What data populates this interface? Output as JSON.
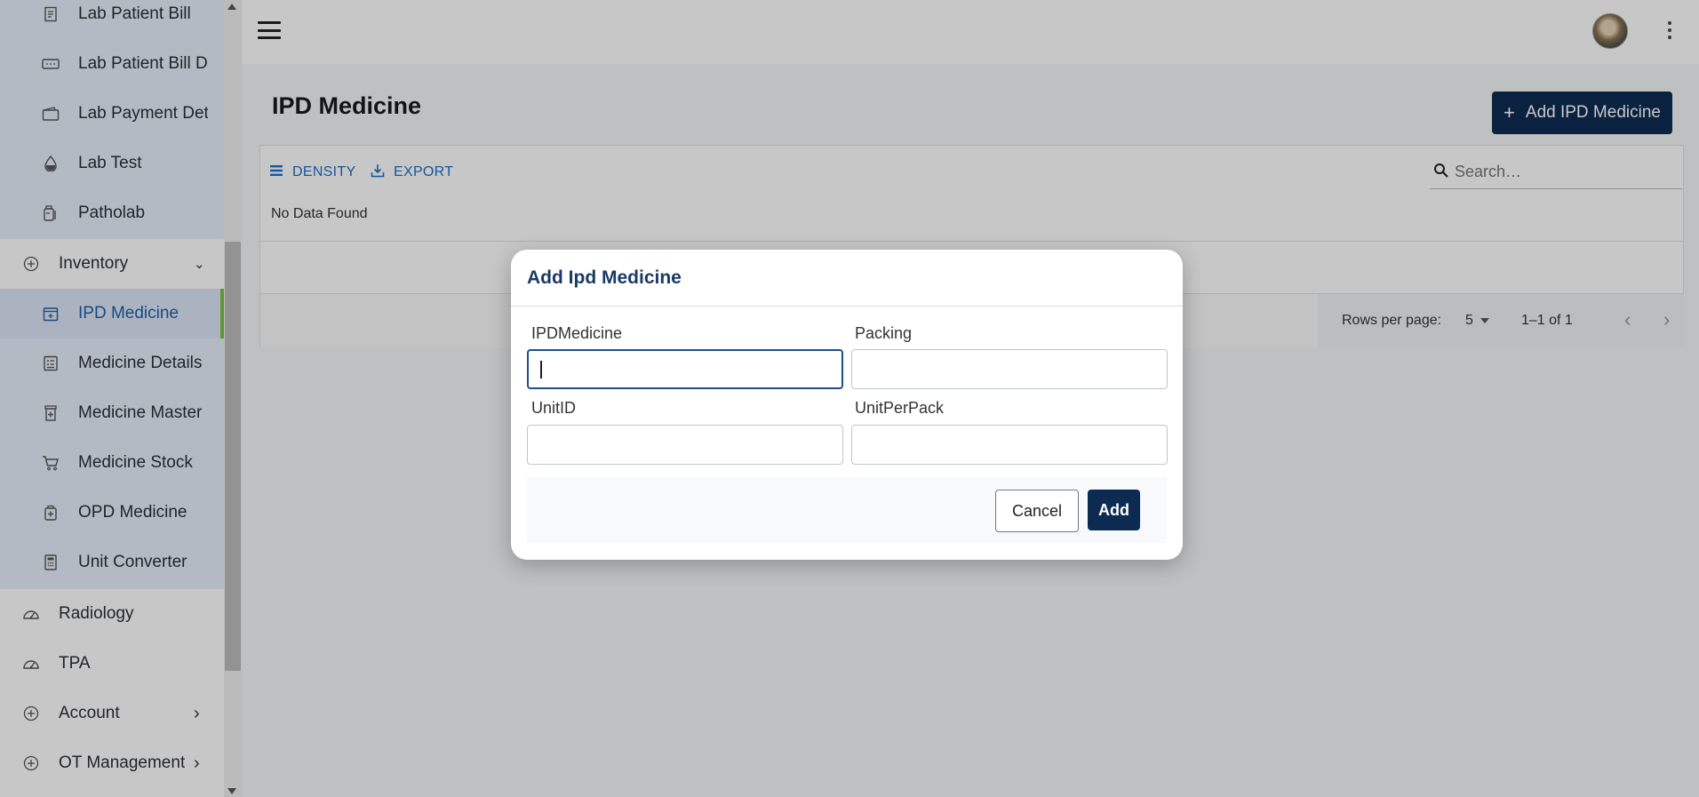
{
  "sidebar": {
    "items": [
      {
        "label": "Lab Patient Bill",
        "icon": "bill-icon",
        "type": "sub"
      },
      {
        "label": "Lab Patient Bill Details",
        "icon": "ticket-icon",
        "type": "sub"
      },
      {
        "label": "Lab Payment Details",
        "icon": "wallet-icon",
        "type": "sub"
      },
      {
        "label": "Lab Test",
        "icon": "drop-icon",
        "type": "sub"
      },
      {
        "label": "Patholab",
        "icon": "bottle-icon",
        "type": "sub"
      },
      {
        "label": "Inventory",
        "icon": "plus-circle-icon",
        "type": "top",
        "chevron": "⌄"
      },
      {
        "label": "IPD Medicine",
        "icon": "calendar-plus-icon",
        "type": "sub",
        "active": true
      },
      {
        "label": "Medicine Details",
        "icon": "list-icon",
        "type": "sub"
      },
      {
        "label": "Medicine Master",
        "icon": "medicine-box-icon",
        "type": "sub"
      },
      {
        "label": "Medicine Stock",
        "icon": "cart-icon",
        "type": "sub"
      },
      {
        "label": "OPD Medicine",
        "icon": "medkit-icon",
        "type": "sub"
      },
      {
        "label": "Unit Converter",
        "icon": "calculator-icon",
        "type": "sub"
      },
      {
        "label": "Radiology",
        "icon": "gauge-icon",
        "type": "top"
      },
      {
        "label": "TPA",
        "icon": "gauge-icon",
        "type": "top"
      },
      {
        "label": "Account",
        "icon": "plus-circle-icon",
        "type": "top",
        "chevron": "›"
      },
      {
        "label": "OT Management",
        "icon": "plus-circle-icon",
        "type": "top",
        "chevron": "›"
      }
    ]
  },
  "header": {
    "menu_icon": "hamburger-icon",
    "avatar_icon": "avatar",
    "more_icon": "kebab-icon"
  },
  "main": {
    "title": "IPD Medicine",
    "add_button_label": "Add IPD Medicine",
    "toolbar": {
      "density_label": "DENSITY",
      "export_label": "EXPORT",
      "search_placeholder": "Search…"
    },
    "empty_text": "No Data Found",
    "pagination": {
      "rows_per_page_label": "Rows per page:",
      "rows_per_page_value": "5",
      "range_text": "1–1 of 1"
    }
  },
  "modal": {
    "title": "Add Ipd Medicine",
    "fields": [
      {
        "label": "IPDMedicine",
        "value": ""
      },
      {
        "label": "Packing",
        "value": ""
      },
      {
        "label": "UnitID",
        "value": ""
      },
      {
        "label": "UnitPerPack",
        "value": ""
      }
    ],
    "cancel_label": "Cancel",
    "add_label": "Add"
  },
  "colors": {
    "primary": "#0d2b52",
    "accent_link": "#1e6fc9",
    "active_indicator": "#7cc242",
    "submenu_bg": "#e7effa"
  }
}
